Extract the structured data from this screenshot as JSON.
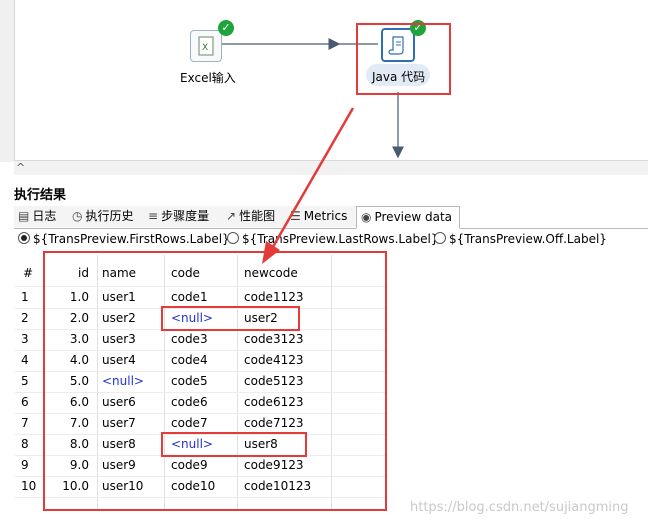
{
  "canvas": {
    "steps": [
      {
        "label": "Excel输入"
      },
      {
        "label": "Java 代码"
      }
    ]
  },
  "results": {
    "title": "执行结果",
    "tabs": [
      "日志",
      "执行历史",
      "步骤度量",
      "性能图",
      "Metrics",
      "Preview data"
    ],
    "active_tab": "Preview data",
    "radios": [
      "${TransPreview.FirstRows.Label}",
      "${TransPreview.LastRows.Label}",
      "${TransPreview.Off.Label}"
    ],
    "selected_radio": 0
  },
  "table": {
    "columns": [
      "#",
      "id",
      "name",
      "code",
      "newcode"
    ],
    "rows": [
      [
        "1",
        "1.0",
        "user1",
        "code1",
        "code1123"
      ],
      [
        "2",
        "2.0",
        "user2",
        "<null>",
        "user2"
      ],
      [
        "3",
        "3.0",
        "user3",
        "code3",
        "code3123"
      ],
      [
        "4",
        "4.0",
        "user4",
        "code4",
        "code4123"
      ],
      [
        "5",
        "5.0",
        "<null>",
        "code5",
        "code5123"
      ],
      [
        "6",
        "6.0",
        "user6",
        "code6",
        "code6123"
      ],
      [
        "7",
        "7.0",
        "user7",
        "code7",
        "code7123"
      ],
      [
        "8",
        "8.0",
        "user8",
        "<null>",
        "user8"
      ],
      [
        "9",
        "9.0",
        "user9",
        "code9",
        "code9123"
      ],
      [
        "10",
        "10.0",
        "user10",
        "code10",
        "code10123"
      ]
    ]
  },
  "watermark": "https://blog.csdn.net/sujiangming",
  "colors": {
    "highlight": "#e53a3a",
    "null_text": "#2233cc",
    "check": "#1ea43a"
  }
}
